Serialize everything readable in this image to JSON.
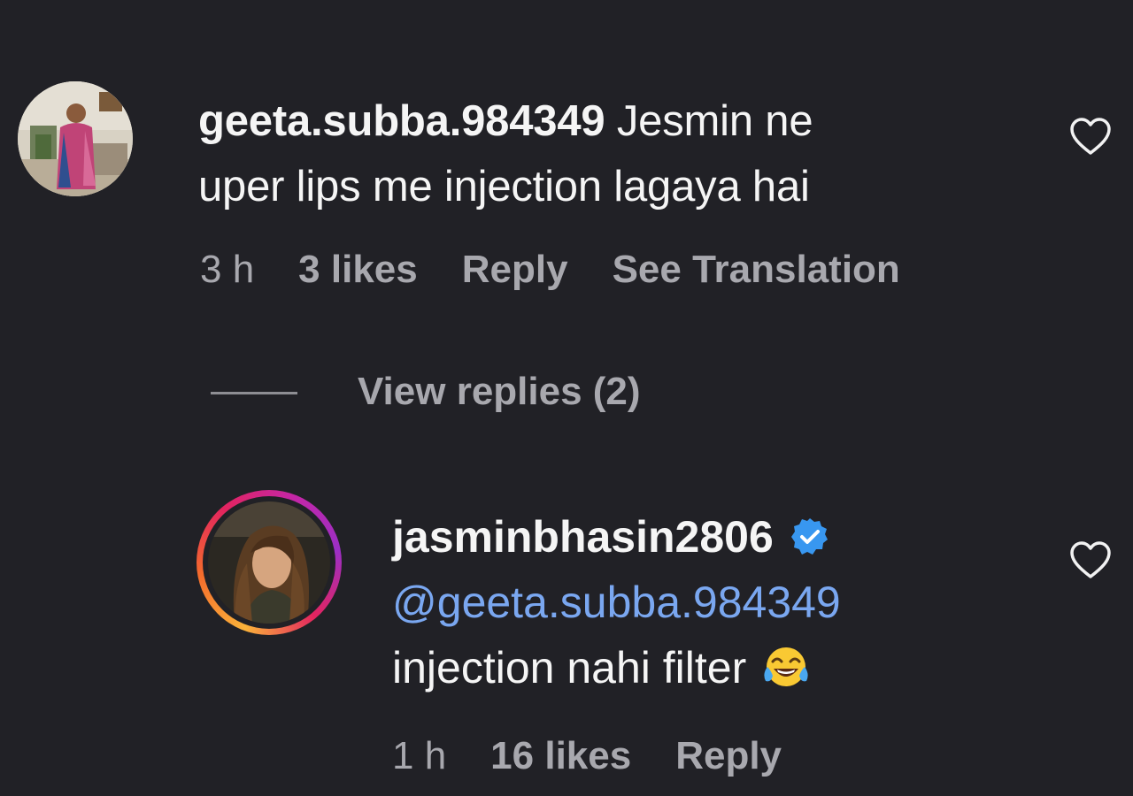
{
  "comment": {
    "avatar_icon": "user-avatar-photo",
    "username": "geeta.subba.984349",
    "text_line1": "Jesmin ne",
    "text_line2": "uper lips me injection lagaya hai",
    "time": "3 h",
    "likes": "3 likes",
    "reply_label": "Reply",
    "translate_label": "See Translation",
    "like_icon": "heart-outline-icon"
  },
  "view_replies": {
    "label": "View replies (2)"
  },
  "reply": {
    "avatar_icon": "story-ring-avatar",
    "username": "jasminbhasin2806",
    "verified_icon": "verified-badge-icon",
    "mention": "@geeta.subba.984349",
    "text": "injection nahi filter",
    "emoji_icon": "tears-of-joy-emoji",
    "time": "1 h",
    "likes": "16 likes",
    "reply_label": "Reply",
    "like_icon": "heart-outline-icon"
  },
  "colors": {
    "background": "#212126",
    "primary_text": "#f5f5f5",
    "secondary_text": "#a8a8ae",
    "mention": "#7aa7f0",
    "verified": "#3897f0"
  }
}
